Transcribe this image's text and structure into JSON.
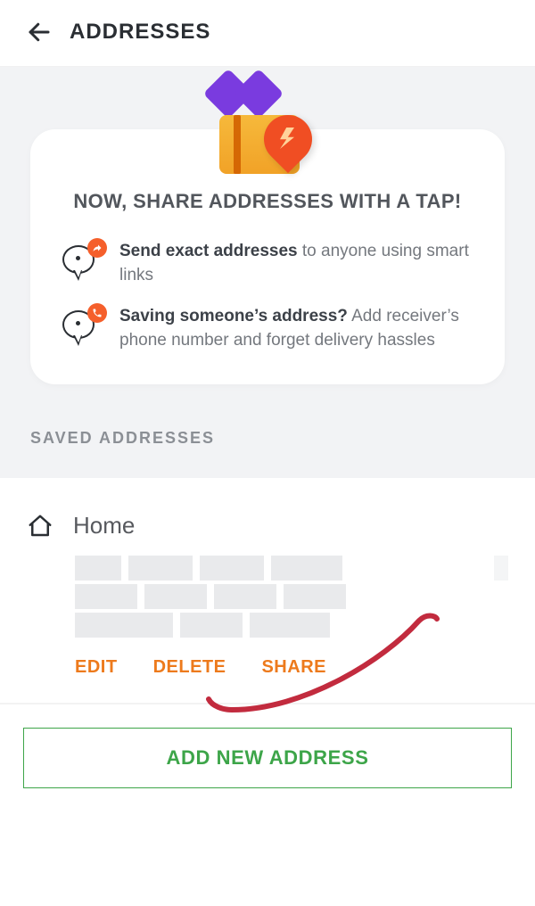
{
  "header": {
    "title": "ADDRESSES"
  },
  "promo": {
    "title": "NOW, SHARE ADDRESSES WITH A TAP!",
    "features": [
      {
        "bold": "Send exact addresses",
        "rest": " to anyone using smart links",
        "icon": "share"
      },
      {
        "bold": "Saving someone’s address?",
        "rest": " Add receiver’s phone number and forget delivery hassles",
        "icon": "phone"
      }
    ]
  },
  "sections": {
    "saved_label": "SAVED ADDRESSES"
  },
  "addresses": [
    {
      "name": "Home",
      "actions": {
        "edit": "EDIT",
        "delete": "DELETE",
        "share": "SHARE"
      }
    }
  ],
  "add_button": "ADD NEW ADDRESS",
  "colors": {
    "accent_orange": "#ed7a1c",
    "accent_green": "#3da549"
  }
}
